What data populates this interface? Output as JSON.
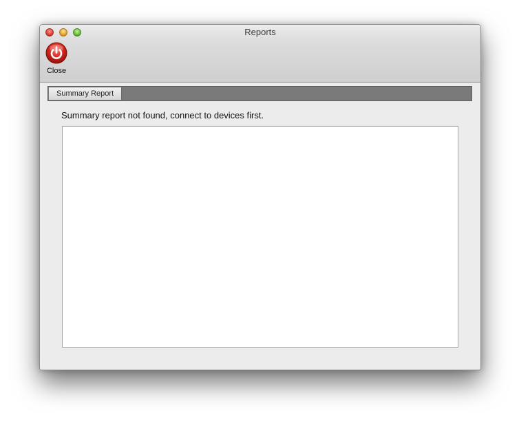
{
  "window": {
    "title": "Reports"
  },
  "toolbar": {
    "close_label": "Close",
    "close_icon": "power-icon",
    "close_icon_color": "#d0261c"
  },
  "tabs": [
    {
      "label": "Summary Report",
      "selected": true
    }
  ],
  "main": {
    "message": "Summary report not found, connect to devices first.",
    "report_text": ""
  }
}
